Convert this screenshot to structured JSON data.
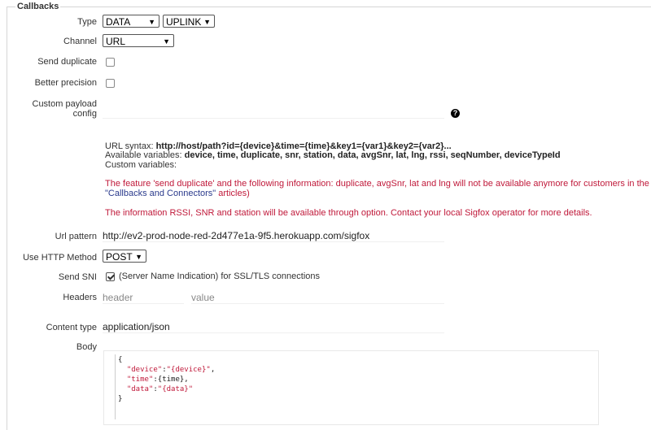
{
  "fieldset": {
    "legend": "Callbacks"
  },
  "type": {
    "label": "Type",
    "type_value": "DATA",
    "direction_value": "UPLINK"
  },
  "channel": {
    "label": "Channel",
    "value": "URL"
  },
  "send_duplicate": {
    "label": "Send duplicate",
    "checked": false
  },
  "better_precision": {
    "label": "Better precision",
    "checked": false
  },
  "custom_payload": {
    "label_line1": "Custom payload",
    "label_line2": "config",
    "value": "",
    "help_icon": "question-icon"
  },
  "url_info": {
    "syntax_label": "URL syntax: ",
    "syntax_value": "http://host/path?id={device}&time={time}&key1={var1}&key2={var2}...",
    "available_label": "Available variables: ",
    "available_value": "device, time, duplicate, snr, station, data, avgSnr, lat, lng, rssi, seqNumber, deviceTypeId",
    "custom_label": "Custom variables:",
    "warning1_line1": "The feature 'send duplicate' and the following information: duplicate, avgSnr, lat and lng will not be available anymore for customers in the DATA",
    "warning1_link": "\"Callbacks and Connectors\"",
    "warning1_line2_rest": " articles)",
    "warning2": "The information RSSI, SNR and station will be available through option. Contact your local Sigfox operator for more details."
  },
  "url_pattern": {
    "label": "Url pattern",
    "value": "http://ev2-prod-node-red-2d477e1a-9f5.herokuapp.com/sigfox"
  },
  "http_method": {
    "label": "Use HTTP Method",
    "value": "POST"
  },
  "send_sni": {
    "label": "Send SNI",
    "checked": true,
    "text": "(Server Name Indication) for SSL/TLS connections"
  },
  "headers": {
    "label": "Headers",
    "header_placeholder": "header",
    "value_placeholder": "value"
  },
  "content_type": {
    "label": "Content type",
    "value": "application/json"
  },
  "body": {
    "label": "Body",
    "lines": [
      "{",
      "  \"device\":\"{device}\",",
      "  \"time\":{time},",
      "  \"data\":\"{data}\"",
      "}"
    ]
  },
  "colors": {
    "warning": "#c0193a",
    "link": "#2a3a8c"
  }
}
